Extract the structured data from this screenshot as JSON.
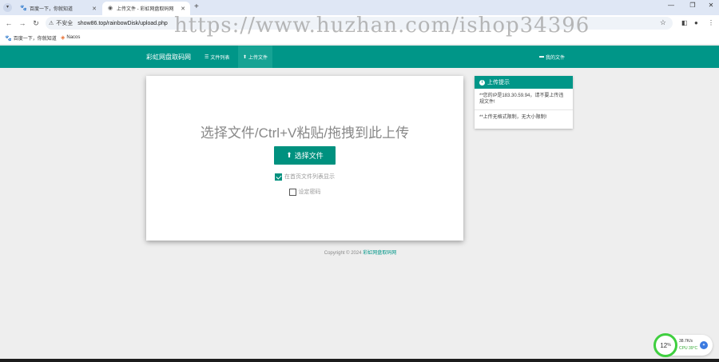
{
  "browser": {
    "tabs": [
      {
        "title": "百度一下，你就知道",
        "active": false,
        "icon": "baidu-icon"
      },
      {
        "title": "上传文件 - 彩虹网盘取码网",
        "active": true,
        "icon": "globe-icon"
      }
    ],
    "security_label": "不安全",
    "url": "show86.top/rainbowDisk/upload.php",
    "bookmarks": [
      {
        "label": "百度一下，你就知道",
        "icon": "baidu-icon"
      },
      {
        "label": "Nacos",
        "icon": "nacos-icon"
      }
    ]
  },
  "watermark": "https://www.huzhan.com/ishop34396",
  "navbar": {
    "brand": "彩虹网盘取码网",
    "links": [
      {
        "label": "文件列表",
        "icon": "list-icon",
        "active": false
      },
      {
        "label": "上传文件",
        "icon": "upload-icon",
        "active": true
      }
    ],
    "my_files": "我的文件"
  },
  "upload": {
    "drop_title": "选择文件/Ctrl+V粘贴/拖拽到此上传",
    "select_button": "选择文件",
    "options": [
      {
        "label": "在首页文件列表显示",
        "checked": true
      },
      {
        "label": "设定密码",
        "checked": false
      }
    ]
  },
  "sidebar": {
    "title": "上传提示",
    "items": [
      "**您的IP是183.30.59.94，请不要上传违规文件!",
      "**上传无格式限制，无大小限制!"
    ]
  },
  "footer": {
    "copyright": "Copyright © 2024 ",
    "link": "彩虹网盘取码网"
  },
  "widget": {
    "percent": "12",
    "percent_unit": "%",
    "net": "38.7K/s",
    "cpu": "CPU 39°C"
  },
  "colors": {
    "brand": "#009688",
    "button": "#00917f"
  }
}
